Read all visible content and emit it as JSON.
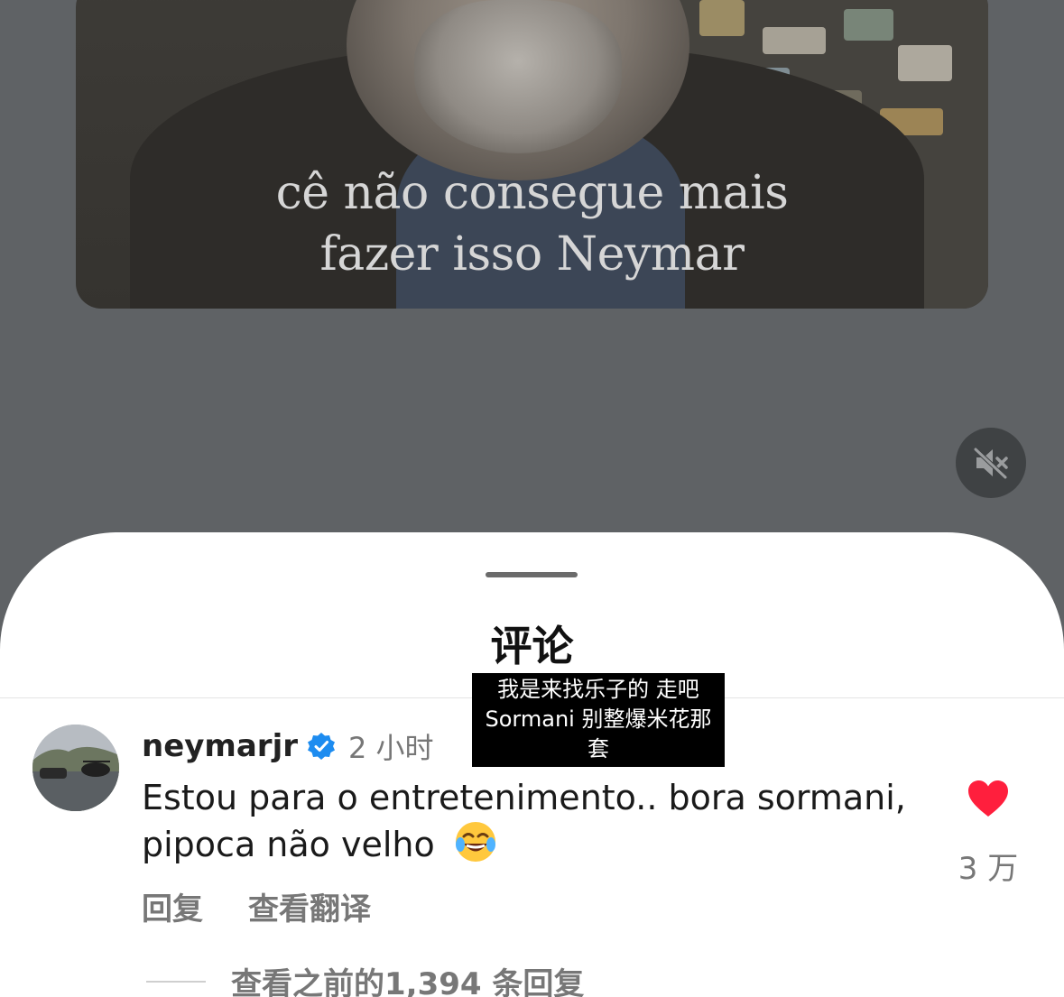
{
  "video": {
    "subtitle_line1": "cê não consegue mais",
    "subtitle_line2": "fazer isso Neymar",
    "mute_icon": "speaker-muted-icon"
  },
  "sheet": {
    "title": "评论"
  },
  "tooltip": {
    "line1": "我是来找乐子的 走吧",
    "line2": "Sormani 别整爆米花那",
    "line3": "套"
  },
  "comment": {
    "username": "neymarjr",
    "verified_icon": "verified-badge-icon",
    "time": "2 小时",
    "text": "Estou para o entretenimento.. bora sormani, pipoca não velho",
    "emoji": "😂",
    "like_icon": "heart-icon",
    "like_color": "#ff1f3d",
    "like_count": "3 万",
    "reply_label": "回复",
    "translate_label": "查看翻译"
  },
  "replies": {
    "view_previous": "查看之前的1,394 条回复"
  }
}
